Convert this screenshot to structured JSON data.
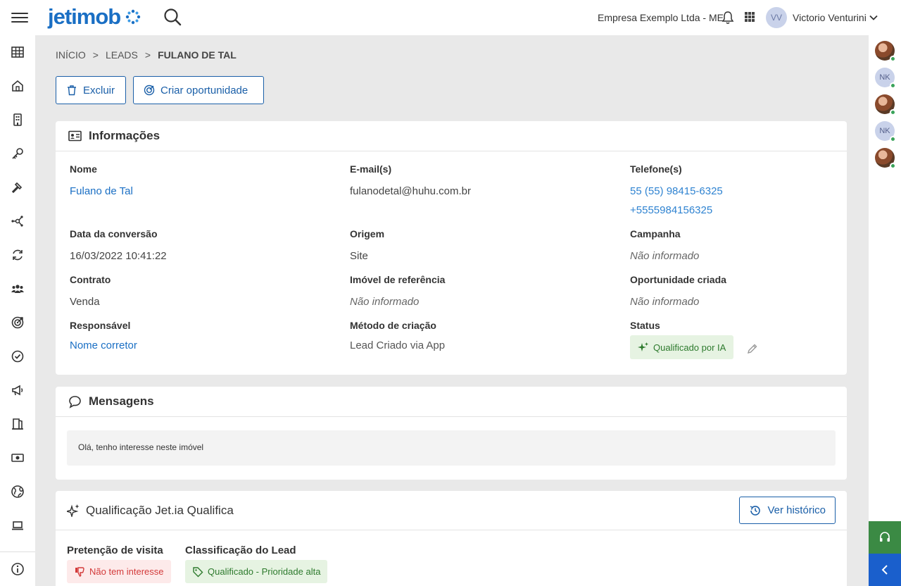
{
  "topbar": {
    "logo": "jetimob",
    "company": "Empresa Exemplo Ltda - ME",
    "user_initials": "VV",
    "user_name": "Victorio Venturini"
  },
  "breadcrumb": {
    "home": "INÍCIO",
    "leads": "LEADS",
    "current": "FULANO DE TAL",
    "separator": ">"
  },
  "actions": {
    "delete": "Excluir",
    "create_opportunity": "Criar oportunidade"
  },
  "info": {
    "title": "Informações",
    "nome_label": "Nome",
    "nome_value": "Fulano de Tal",
    "email_label": "E-mail(s)",
    "email_value": "fulanodetal@huhu.com.br",
    "telefone_label": "Telefone(s)",
    "phones": [
      "55 (55) 98415-6325",
      "+5555984156325"
    ],
    "data_label": "Data da conversão",
    "data_value": "16/03/2022 10:41:22",
    "origem_label": "Origem",
    "origem_value": "Site",
    "campanha_label": "Campanha",
    "campanha_value": "Não informado",
    "contrato_label": "Contrato",
    "contrato_value": "Venda",
    "imovel_label": "Imóvel de referência",
    "imovel_value": "Não informado",
    "oportunidade_label": "Oportunidade criada",
    "oportunidade_value": "Não informado",
    "responsavel_label": "Responsável",
    "responsavel_value": "Nome corretor",
    "metodo_label": "Método de criação",
    "metodo_value": "Lead Criado via App",
    "status_label": "Status",
    "status_value": "Qualificado por IA"
  },
  "messages": {
    "title": "Mensagens",
    "text": "Olá, tenho interesse neste imóvel"
  },
  "qualification": {
    "title": "Qualificação Jet.ia Qualifica",
    "history_button": "Ver histórico",
    "visit_label": "Pretenção de visita",
    "visit_value": "Não tem interesse",
    "class_label": "Classificação do Lead",
    "class_value": "Qualificado - Prioridade alta"
  },
  "right_rail": {
    "avatars": [
      "photo",
      "NK",
      "photo",
      "NK",
      "photo"
    ]
  },
  "colors": {
    "brand": "#1a6fc4",
    "online": "#3aa35a",
    "status_green_bg": "#e6f3e2",
    "status_green_text": "#2d7a2d",
    "negative_red": "#d33a3a"
  }
}
